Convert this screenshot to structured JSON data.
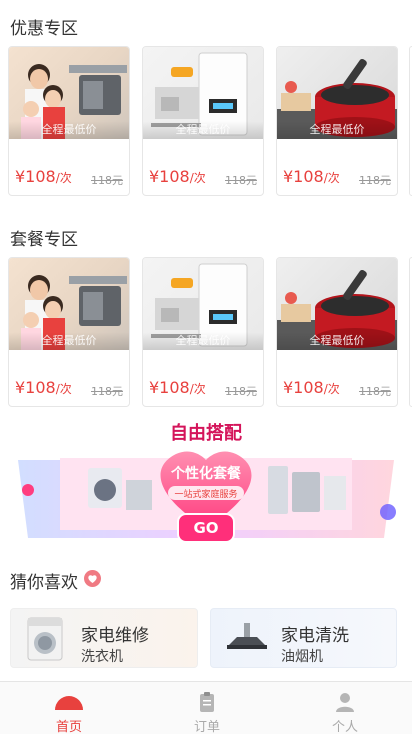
{
  "sections": {
    "discount_title": "优惠专区",
    "package_title": "套餐专区",
    "guess_title": "猜你喜欢"
  },
  "cards": [
    {
      "caption": "全程最低价",
      "price": "¥108",
      "unit": "/次",
      "original": "118元"
    },
    {
      "caption": "全程最低价",
      "price": "¥108",
      "unit": "/次",
      "original": "118元"
    },
    {
      "caption": "全程最低价",
      "price": "¥108",
      "unit": "/次",
      "original": "118元"
    }
  ],
  "package_cards": [
    {
      "caption": "全程最低价",
      "price": "¥108",
      "unit": "/次",
      "original": "118元"
    },
    {
      "caption": "全程最低价",
      "price": "¥108",
      "unit": "/次",
      "original": "118元"
    },
    {
      "caption": "全程最低价",
      "price": "¥108",
      "unit": "/次",
      "original": "118元"
    }
  ],
  "banner": {
    "headline": "自由搭配",
    "title": "个性化套餐",
    "subtitle": "一站式家庭服务",
    "go": "GO"
  },
  "recommend": [
    {
      "title": "家电维修",
      "subtitle": "洗衣机"
    },
    {
      "title": "家电清洗",
      "subtitle": "油烟机"
    }
  ],
  "tabs": [
    {
      "label": "首页",
      "active": true
    },
    {
      "label": "订单",
      "active": false
    },
    {
      "label": "个人",
      "active": false
    }
  ],
  "colors": {
    "accent": "#e8413e",
    "tab_inactive": "#aaaaaa"
  },
  "icons": {
    "home": "home-icon",
    "order": "clipboard-icon",
    "profile": "person-icon",
    "heart": "heart-icon"
  }
}
